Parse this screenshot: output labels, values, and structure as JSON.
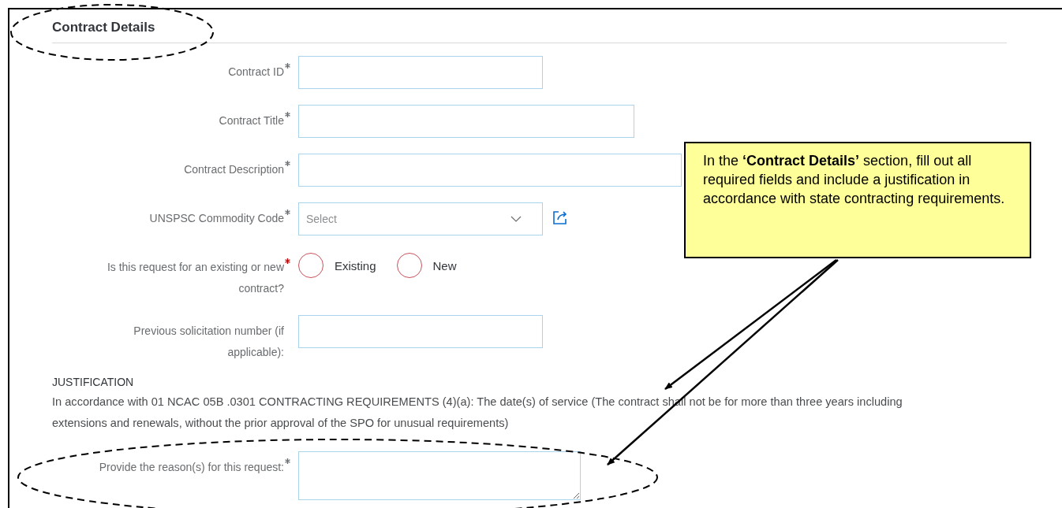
{
  "section": {
    "title": "Contract Details"
  },
  "fields": [
    {
      "kind": "text",
      "label": "Contract ID",
      "required": true
    },
    {
      "kind": "text",
      "label": "Contract Title",
      "required": true
    },
    {
      "kind": "text",
      "label": "Contract Description",
      "required": true
    },
    {
      "kind": "select",
      "label": "UNSPSC Commodity Code",
      "required": true,
      "placeholder": "Select"
    },
    {
      "kind": "radio",
      "label": "Is this request for an existing or new contract?",
      "required": true,
      "invalid": true,
      "options": [
        {
          "label": "Existing",
          "selected": false
        },
        {
          "label": "New",
          "selected": false
        }
      ]
    },
    {
      "kind": "text",
      "label": "Previous solicitation number (if applicable):",
      "required": false
    }
  ],
  "justification": {
    "heading": "JUSTIFICATION",
    "text": "In accordance with 01 NCAC 05B .0301 CONTRACTING REQUIREMENTS (4)(a): The date(s) of service (The contract shall not be for more than three years including extensions and renewals, without the prior approval of the SPO for unusual requirements)"
  },
  "reason": {
    "kind": "textarea",
    "label": "Provide the reason(s) for this request:",
    "required": true
  },
  "callout": {
    "text": "In the **‘Contract Details’** section, fill out all required fields and include a justification in accordance with state contracting requirements."
  }
}
